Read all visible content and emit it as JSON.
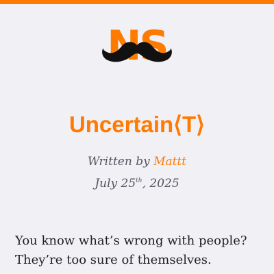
{
  "site": {
    "logo_text": "NS",
    "logo_icon": "mustache-icon",
    "accent_color": "#ff7a00"
  },
  "article": {
    "title": "Uncertain⟨T⟩",
    "byline_prefix": "Written by",
    "author": "Mattt",
    "date": {
      "month_day": "July 25",
      "ordinal_suffix": "th",
      "year_sep": ", 2025"
    },
    "body_line_1": "You know what’s wrong with people?",
    "body_line_2": "They’re too sure of themselves."
  }
}
